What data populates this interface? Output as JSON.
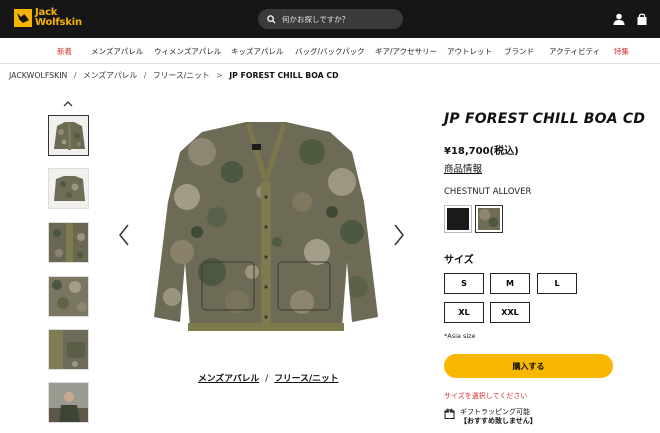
{
  "header": {
    "logo_line1": "Jack",
    "logo_line2": "Wolfskin",
    "search_placeholder": "何かお探しですか？",
    "icons": [
      "search-icon",
      "user-icon",
      "bag-icon"
    ]
  },
  "nav": {
    "items": [
      {
        "label": "新着",
        "highlight": true
      },
      {
        "label": "メンズアパレル",
        "highlight": false
      },
      {
        "label": "ウィメンズアパレル",
        "highlight": false
      },
      {
        "label": "キッズアパレル",
        "highlight": false
      },
      {
        "label": "バッグ/バックパック",
        "highlight": false
      },
      {
        "label": "ギア/アクセサリー",
        "highlight": false
      },
      {
        "label": "アウトレット",
        "highlight": false
      },
      {
        "label": "ブランド",
        "highlight": false
      },
      {
        "label": "アクティビティ",
        "highlight": false
      },
      {
        "label": "特集",
        "highlight": true
      }
    ]
  },
  "breadcrumb": {
    "items": [
      "JACKWOLFSKIN",
      "メンズアパレル",
      "フリース/ニット"
    ],
    "separator": "/",
    "current_marker": ">",
    "current": "JP FOREST CHILL BOA CD"
  },
  "gallery": {
    "thumbnail_count": 6,
    "active_index": 0
  },
  "category_links": [
    "メンズアパレル",
    "フリース/ニット"
  ],
  "category_separator": "/",
  "product": {
    "title": "JP FOREST CHILL BOA CD",
    "price": "¥18,700(税込)",
    "info_link": "商品情報",
    "color_name": "CHESTNUT ALLOVER",
    "swatches": [
      {
        "name": "black",
        "color": "#1a1a1a",
        "selected": false
      },
      {
        "name": "chestnut-allover",
        "color": "#6f6b55",
        "selected": true
      }
    ],
    "size_label": "サイズ",
    "sizes": [
      "S",
      "M",
      "L",
      "XL",
      "XXL"
    ],
    "size_note": "*Asia size",
    "buy_label": "購入する",
    "warning": "サイズを選択してください",
    "gift_line1": "ギフトラッピング可能",
    "gift_line2": "【おすすめ致しません】"
  },
  "colors": {
    "accent": "#f8b700",
    "header_bg": "#161616",
    "warning": "#d0312d"
  }
}
